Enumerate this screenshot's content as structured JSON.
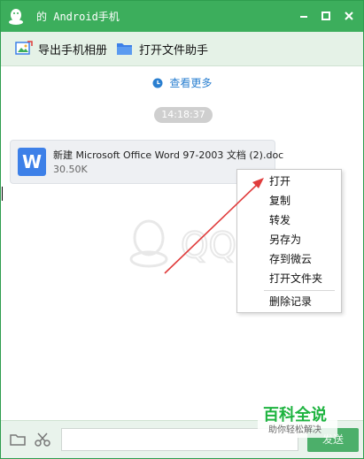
{
  "window": {
    "title": "的 Android手机",
    "buttons": {
      "minimize": "minimize",
      "maximize": "maximize",
      "close": "close"
    }
  },
  "toolbar": {
    "export_album_label": "导出手机相册",
    "open_file_helper_label": "打开文件助手"
  },
  "chat": {
    "more_history": "查看更多",
    "timestamp": "14:18:37",
    "file": {
      "name": "新建 Microsoft Office Word 97-2003 文档 (2).doc",
      "size": "30.50K",
      "icon_letter": "W"
    },
    "watermark": "QQ"
  },
  "context_menu": {
    "items": [
      {
        "label": "打开"
      },
      {
        "label": "复制"
      },
      {
        "label": "转发"
      },
      {
        "label": "另存为"
      },
      {
        "label": "存到微云"
      },
      {
        "label": "打开文件夹"
      },
      {
        "label": "删除记录"
      }
    ]
  },
  "input": {
    "placeholder": "",
    "send_label": "发送"
  },
  "brand": {
    "title": "百科全说",
    "subtitle": "助你轻松解决"
  },
  "colors": {
    "title_green": "#3cae5c",
    "toolbar_bg": "#e5f2e7",
    "link_blue": "#2a7fd0",
    "arrow_red": "#e03c3c",
    "brand_green": "#1db33f",
    "word_blue": "#3d80e8"
  }
}
